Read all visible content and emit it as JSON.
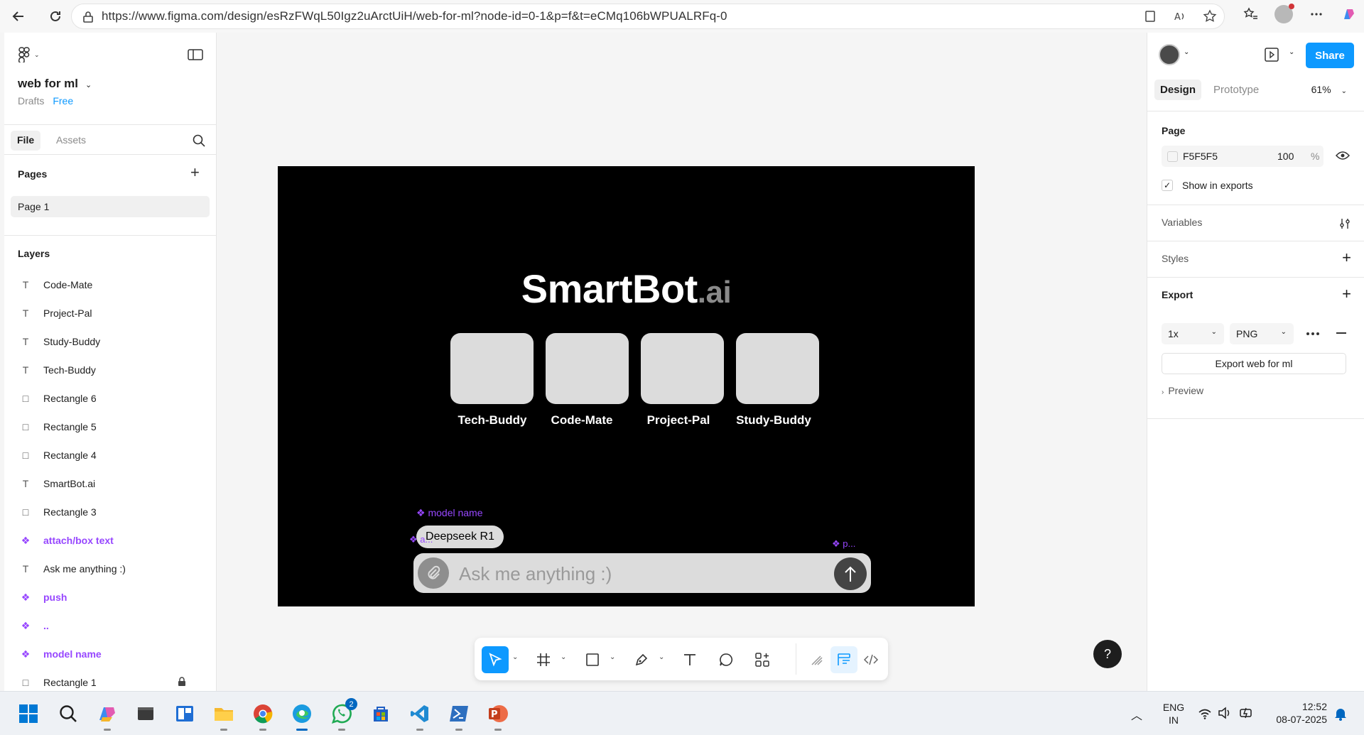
{
  "browser": {
    "url": "https://www.figma.com/design/esRzFWqL50Igz2uArctUiH/web-for-ml?node-id=0-1&p=f&t=eCMq106bWPUALRFq-0"
  },
  "file": {
    "name": "web for ml",
    "location": "Drafts",
    "plan": "Free"
  },
  "left_tabs": {
    "file": "File",
    "assets": "Assets"
  },
  "pages": {
    "header": "Pages",
    "items": [
      "Page 1"
    ]
  },
  "layers": {
    "header": "Layers",
    "items": [
      {
        "name": "Code-Mate",
        "type": "text",
        "icon": "T"
      },
      {
        "name": "Project-Pal",
        "type": "text",
        "icon": "T"
      },
      {
        "name": "Study-Buddy",
        "type": "text",
        "icon": "T"
      },
      {
        "name": "Tech-Buddy",
        "type": "text",
        "icon": "T"
      },
      {
        "name": "Rectangle 6",
        "type": "rect",
        "icon": "□"
      },
      {
        "name": "Rectangle 5",
        "type": "rect",
        "icon": "□"
      },
      {
        "name": "Rectangle 4",
        "type": "rect",
        "icon": "□"
      },
      {
        "name": "SmartBot.ai",
        "type": "text",
        "icon": "T"
      },
      {
        "name": "Rectangle 3",
        "type": "rect",
        "icon": "□"
      },
      {
        "name": "attach/box text",
        "type": "component",
        "icon": "❖"
      },
      {
        "name": "Ask me anything :)",
        "type": "text",
        "icon": "T"
      },
      {
        "name": "push",
        "type": "component",
        "icon": "❖"
      },
      {
        "name": "..",
        "type": "component",
        "icon": "❖"
      },
      {
        "name": "model name",
        "type": "component",
        "icon": "❖"
      },
      {
        "name": "Rectangle 1",
        "type": "rect",
        "icon": "□"
      }
    ]
  },
  "right_panel": {
    "share_label": "Share",
    "tab_design": "Design",
    "tab_prototype": "Prototype",
    "zoom": "61%",
    "page_section": "Page",
    "page_color": "F5F5F5",
    "page_opacity": "100",
    "percent_sign": "%",
    "show_in_exports": "Show in exports",
    "variables": "Variables",
    "styles": "Styles",
    "export": "Export",
    "export_scale": "1x",
    "export_format": "PNG",
    "export_button": "Export web for ml",
    "preview": "Preview"
  },
  "canvas": {
    "brand_main": "SmartBot",
    "brand_suffix": ".ai",
    "cards": [
      "Tech-Buddy",
      "Code-Mate",
      "Project-Pal",
      "Study-Buddy"
    ],
    "model_tag": "model name",
    "model_value": "Deepseek R1",
    "chat_placeholder": "Ask me anything :)",
    "attach_tag": "a...",
    "push_tag": "p..."
  },
  "taskbar": {
    "language": "ENG",
    "region": "IN",
    "time": "12:52",
    "date": "08-07-2025",
    "whatsapp_badge": "2"
  },
  "colors": {
    "accent": "#0d99ff",
    "component": "#9747ff",
    "frame_bg": "#000000"
  }
}
